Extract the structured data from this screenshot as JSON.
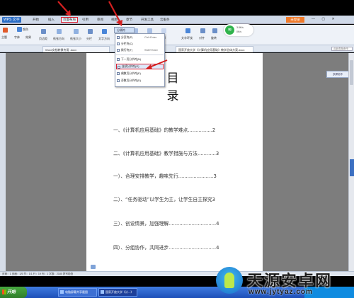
{
  "app": {
    "name": "WPS 文字"
  },
  "menus": [
    {
      "label": "开始"
    },
    {
      "label": "插入"
    },
    {
      "label": "页面布局"
    },
    {
      "label": "引用"
    },
    {
      "label": "审阅"
    },
    {
      "label": "视图"
    },
    {
      "label": "章节"
    },
    {
      "label": "开发工具"
    },
    {
      "label": "云服务"
    }
  ],
  "login_label": "未登录",
  "ribbon": {
    "theme": "主题",
    "color": "颜色",
    "font": "字体",
    "effect": "效果",
    "margin": "页边距",
    "orientation": "纸张方向",
    "size": "纸张大小",
    "columns": "分栏",
    "text_direction": "文字方向",
    "breaks": "分隔符",
    "background": "背景",
    "border": "页面边框",
    "watermark": "水印",
    "text_wrap": "文字环绕",
    "align": "对齐",
    "rotate": "旋转"
  },
  "dropdown": {
    "head": "分隔符",
    "items": [
      {
        "label": "分页符(P)",
        "shortcut": "Ctrl+Enter"
      },
      {
        "label": "分栏符(C)",
        "shortcut": ""
      },
      {
        "label": "换行符(T)",
        "shortcut": "Shift+Enter"
      },
      {
        "label": "下一页分节符(N)",
        "shortcut": ""
      },
      {
        "label": "连续分节符(O)",
        "shortcut": ""
      },
      {
        "label": "偶数页分节符(E)",
        "shortcut": ""
      },
      {
        "label": "奇数页分节符(D)",
        "shortcut": ""
      }
    ]
  },
  "wifi": {
    "line1": "3.8K/s",
    "line2": "0K/s"
  },
  "doc_tabs": [
    {
      "label": "Word文档转换专用 .docx"
    },
    {
      "label": "国家开放大学《计算机应用基础》教学总体方案.docx"
    }
  ],
  "search_placeholder": "点此查找命令",
  "right_panel": "多屏协作",
  "document": {
    "title": "目 录",
    "toc": [
      "一、《计算机应用基础》的教学难点................2",
      "二、《计算机应用基础》教学措施与方法............3",
      "一）、合理安排教学，趣味先行.......................3",
      "二）、“任务驱动”以学生为主，让学生自主探究3",
      "三）、创设情景，加强理解...............................4",
      "四）、分组协作，共同进步...............................4"
    ]
  },
  "statusbar": "页码：1  页面：1/5  节：1/1  行：19  列：1  字数：2180  拼写检查",
  "taskbar": {
    "start": "开始",
    "tasks": [
      {
        "label": "电脑屏幕共享截图"
      },
      {
        "label": "国家开放大学《计...》"
      }
    ]
  },
  "watermark": {
    "name": "天源安卓网",
    "url": "www.jytyaz.com"
  },
  "colors": {
    "highlight_red": "#dd2222",
    "ribbon_bg": "#eef2f8",
    "accent_blue": "#2a6cc4"
  }
}
